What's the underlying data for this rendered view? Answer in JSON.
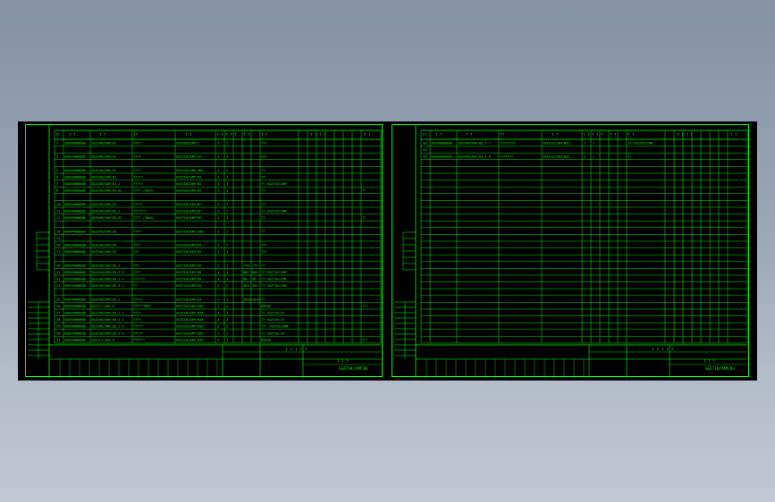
{
  "colors": {
    "line": "#00ff00",
    "paper": "#000000"
  },
  "sheets": [
    {
      "header": [
        "??",
        "? ?",
        "? ?",
        "??",
        "? ?",
        "? ? ? ? ?",
        "? ?",
        "? ?",
        "? ? ? ?",
        "? ?"
      ],
      "rows": [
        {
          "no": "1",
          "code": "SGDV4000000",
          "name": "SGZ240/2AM-B1",
          "spec": "????",
          "dwg": "SGZ710/2AM.1",
          "qty": "1",
          "unit": "1",
          "w1": "",
          "w2": "",
          "note": "???",
          "extra": ""
        },
        {
          "no": "",
          "code": "",
          "name": "",
          "spec": "",
          "dwg": "",
          "qty": "",
          "unit": "",
          "w1": "",
          "w2": "",
          "note": "",
          "extra": ""
        },
        {
          "no": "3",
          "code": "SGDV4000000",
          "name": "SGZ240/2AM-B2",
          "spec": "????",
          "dwg": "SGZ710/2AM.16",
          "qty": "1",
          "unit": "1",
          "w1": "",
          "w2": "",
          "note": "???",
          "extra": ""
        },
        {
          "no": "",
          "code": "",
          "name": "",
          "spec": "",
          "dwg": "",
          "qty": "",
          "unit": "",
          "w1": "",
          "w2": "",
          "note": "",
          "extra": ""
        },
        {
          "no": "5",
          "code": "SGDV4000000",
          "name": "SGZ240/2AM.B1",
          "spec": "????",
          "dwg": "SGZ710/2AM.3B1",
          "qty": "1",
          "unit": "1",
          "w1": "",
          "w2": "",
          "note": "??",
          "extra": ""
        },
        {
          "no": "6",
          "code": "SGDV4000000",
          "name": "SGZ240/2AM.B1",
          "spec": "?????",
          "dwg": "SGZ710/2AM.B1",
          "qty": "1",
          "unit": "1",
          "w1": "",
          "w2": "",
          "note": "??",
          "extra": ""
        },
        {
          "no": "7",
          "code": "SGDV4000000",
          "name": "SGZ240/2AM.B1.1",
          "spec": "?????",
          "dwg": "SGZ710/2AM.B1",
          "qty": "1",
          "unit": "1",
          "w1": "",
          "w2": "",
          "note": "?? SGZ710/2AM",
          "extra": ""
        },
        {
          "no": "8",
          "code": "SGDV4000000",
          "name": "SGZ240/2AM.B1-01",
          "spec": "???? (40x4)",
          "dwg": "SGZ710/2AM.B1",
          "qty": "1",
          "unit": "1",
          "w1": "",
          "w2": "",
          "note": "??",
          "extra": "??"
        },
        {
          "no": "",
          "code": "",
          "name": "",
          "spec": "",
          "dwg": "",
          "qty": "",
          "unit": "",
          "w1": "",
          "w2": "",
          "note": "",
          "extra": ""
        },
        {
          "no": "10",
          "code": "SGDV4000000",
          "name": "SGZ240/2AM.B2",
          "spec": "?????",
          "dwg": "SGZ710/2AM.B2",
          "qty": "1",
          "unit": "1",
          "w1": "",
          "w2": "",
          "note": "??",
          "extra": ""
        },
        {
          "no": "11",
          "code": "SGDV4000000",
          "name": "SGZ240/2AM.B2.1",
          "spec": "???????",
          "dwg": "SGZ710/2AM.B2",
          "qty": "1",
          "unit": "1",
          "w1": "",
          "w2": "",
          "note": "?? SGZ710/2AM",
          "extra": ""
        },
        {
          "no": "12",
          "code": "SGDV4000000",
          "name": "SGZ240/2AM.B2-01",
          "spec": "???? (40x4)",
          "dwg": "SGZ710/2AM.B2",
          "qty": "1",
          "unit": "1",
          "w1": "",
          "w2": "",
          "note": "??",
          "extra": "??"
        },
        {
          "no": "",
          "code": "",
          "name": "",
          "spec": "",
          "dwg": "",
          "qty": "",
          "unit": "",
          "w1": "",
          "w2": "",
          "note": "",
          "extra": ""
        },
        {
          "no": "14",
          "code": "SGDV4000000",
          "name": "SGZ240/2AM.B3",
          "spec": "????",
          "dwg": "SGZ710/2AM.3B3",
          "qty": "1",
          "unit": "1",
          "w1": "",
          "w2": "",
          "note": "??",
          "extra": ""
        },
        {
          "no": "15",
          "code": "",
          "name": "",
          "spec": "",
          "dwg": "",
          "qty": "",
          "unit": "",
          "w1": "",
          "w2": "",
          "note": "",
          "extra": ""
        },
        {
          "no": "16",
          "code": "SGDV4000000",
          "name": "SGZ240/2AM.B3",
          "spec": "????",
          "dwg": "SGZ710/2AM.B3",
          "qty": "1",
          "unit": "1",
          "w1": "",
          "w2": "",
          "note": "???",
          "extra": ""
        },
        {
          "no": "17",
          "code": "SGDV4000000",
          "name": "SGZ240/2AM.B3",
          "spec": "???",
          "dwg": "SGZ710/2AM.B3",
          "qty": "1",
          "unit": "1",
          "w1": "",
          "w2": "",
          "note": "???",
          "extra": ""
        },
        {
          "no": "",
          "code": "",
          "name": "",
          "spec": "",
          "dwg": "",
          "qty": "",
          "unit": "",
          "w1": "",
          "w2": "",
          "note": "",
          "extra": ""
        },
        {
          "no": "20",
          "code": "SGDV4000000",
          "name": "SGZ240/2AM.B3.1",
          "spec": "???",
          "dwg": "SGZ710/2AM.B3",
          "qty": "1",
          "unit": "1",
          "w1": "770",
          "w2": "770",
          "note": "??",
          "extra": ""
        },
        {
          "no": "21",
          "code": "SGDV4000000",
          "name": "SGZ240/2AM.B3.3-5",
          "spec": "????",
          "dwg": "SGZ710/2AM.B3",
          "qty": "1",
          "unit": "1",
          "w1": "685",
          "w2": "685",
          "note": "?? SGZ710/2AM",
          "extra": ""
        },
        {
          "no": "22",
          "code": "SGDV4000000",
          "name": "SGZ240/2AM.B3.3-3",
          "spec": "??????",
          "dwg": "SGZ710/2AM.B3",
          "qty": "1",
          "unit": "1",
          "w1": "96",
          "w2": "96",
          "note": "?? SGZ710/2AM",
          "extra": ""
        },
        {
          "no": "23",
          "code": "SGDV4000000",
          "name": "SGZ240/2AM.B3.3.1",
          "spec": "??",
          "dwg": "SGZ710/2AM.B3",
          "qty": "1",
          "unit": "1",
          "w1": "163",
          "w2": "163",
          "note": "?? SGZ710/2AM",
          "extra": ""
        },
        {
          "no": "",
          "code": "",
          "name": "",
          "spec": "",
          "dwg": "",
          "qty": "",
          "unit": "",
          "w1": "",
          "w2": "",
          "note": "",
          "extra": ""
        },
        {
          "no": "25",
          "code": "SGDV4000000",
          "name": "SGZ240/2AM.B3.2",
          "spec": "?????",
          "dwg": "SGZ710/2AM.B3",
          "qty": "1",
          "unit": "1",
          "w1": "1628",
          "w2": "1628",
          "note": "??",
          "extra": ""
        },
        {
          "no": "26",
          "code": "SGDV4000000",
          "name": "SGZ711.400.9",
          "spec": "??????M20",
          "dwg": "SGZ710/2AM.B32",
          "qty": "1",
          "unit": "1",
          "w1": "",
          "w2": "",
          "note": "M20x8",
          "extra": "???"
        },
        {
          "no": "27",
          "code": "SGDV4000000",
          "name": "SGZ240/2AM.B3.2-1",
          "spec": "????",
          "dwg": "SGZ710/2AM.B32",
          "qty": "1",
          "unit": "1",
          "w1": "",
          "w2": "",
          "note": "?? SGZ710/2A",
          "extra": ""
        },
        {
          "no": "28",
          "code": "SGDV4000000",
          "name": "SGZ240/2AM.B3.2-2",
          "spec": "????",
          "dwg": "SGZ710/2AM.B32",
          "qty": "1",
          "unit": "1",
          "w1": "",
          "w2": "",
          "note": "?? SGZ710/2A",
          "extra": ""
        },
        {
          "no": "29",
          "code": "SGDV4000000",
          "name": "SGZ240/2AM.B3.2-3",
          "spec": "?????",
          "dwg": "SGZ710/2AM.B32",
          "qty": "2",
          "unit": "2",
          "w1": "",
          "w2": "",
          "note": "??? SGZ710/2AM",
          "extra": ""
        },
        {
          "no": "30",
          "code": "SGDV4000000",
          "name": "SGZ240/2AM.B3.2-6",
          "spec": "?????",
          "dwg": "SGZ710/2AM.B32",
          "qty": "1",
          "unit": "1",
          "w1": "",
          "w2": "",
          "note": "?? SGZ710/2A",
          "extra": ""
        },
        {
          "no": "31",
          "code": "SGDV4000000",
          "name": "SGZ711.400.6",
          "spec": "??????",
          "dwg": "SGZ710/2AM.B32",
          "qty": "1",
          "unit": "1",
          "w1": "",
          "w2": "",
          "note": "M20x8",
          "extra": "???"
        }
      ],
      "title_block": {
        "name": "? ? ? ? ?",
        "doc": "? ? ?",
        "code": "SGZ710/2AM.B2"
      }
    },
    {
      "header": [
        "??",
        "? ?",
        "? ?",
        "??",
        "? ?",
        "? ? ? ? ?",
        "? ?",
        "? ?",
        "? ? ? ?",
        "? ?"
      ],
      "rows": [
        {
          "no": "32",
          "code": "SGDV4000000",
          "name": "SGZ240/2AM.B3.2-7",
          "spec": "????????",
          "dwg": "SGZ710/2AM.B32",
          "qty": "1",
          "unit": "1",
          "w1": "",
          "w2": "",
          "note": "?? SGZ710/2AM",
          "extra": ""
        },
        {
          "no": "33",
          "code": "",
          "name": "",
          "spec": "",
          "dwg": "",
          "qty": "",
          "unit": "",
          "w1": "",
          "w2": "",
          "note": "",
          "extra": ""
        },
        {
          "no": "34",
          "code": "SGDV4000000",
          "name": "SGZ240/2AM.B3.2-6",
          "spec": "???????",
          "dwg": "SGZ710/2AM.B32",
          "qty": "1",
          "unit": "1",
          "w1": "",
          "w2": "",
          "note": "??",
          "extra": ""
        }
      ],
      "title_block": {
        "name": "? ? ? ? ?",
        "doc": "? ? ?",
        "code": "SGZ710/2AM.B3"
      }
    }
  ]
}
